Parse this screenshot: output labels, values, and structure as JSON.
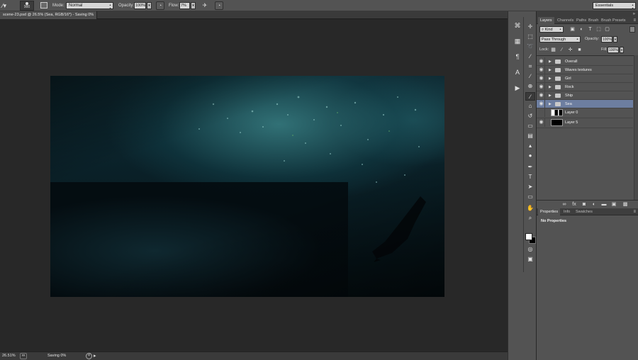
{
  "options_bar": {
    "brush_size": "900",
    "mode_label": "Mode:",
    "mode_value": "Normal",
    "opacity_label": "Opacity:",
    "opacity_value": "100%",
    "flow_label": "Flow:",
    "flow_value": "7%",
    "workspace": "Essentials"
  },
  "document": {
    "tab_title": "scene-23.psd @ 26.5% (Sea, RGB/16*) - Saving 0%"
  },
  "status_bar": {
    "zoom": "26.51%",
    "status": "Saving 0%"
  },
  "layers_panel": {
    "tabs": [
      "Layers",
      "Channels",
      "Paths",
      "Brush",
      "Brush Presets"
    ],
    "kind_filter": "Kind",
    "blend_mode": "Pass Through",
    "opacity_label": "Opacity:",
    "opacity_value": "100%",
    "lock_label": "Lock:",
    "fill_label": "Fill:",
    "fill_value": "100%",
    "layers": [
      {
        "name": "Overall",
        "type": "group",
        "visible": true,
        "selected": false
      },
      {
        "name": "Waves textures",
        "type": "group",
        "visible": true,
        "selected": false
      },
      {
        "name": "Girl",
        "type": "group",
        "visible": true,
        "selected": false
      },
      {
        "name": "Rock",
        "type": "group",
        "visible": true,
        "selected": false
      },
      {
        "name": "Ship",
        "type": "group",
        "visible": true,
        "selected": false
      },
      {
        "name": "Sea",
        "type": "group",
        "visible": true,
        "selected": true
      },
      {
        "name": "Layer 0",
        "type": "pixel",
        "visible": false,
        "selected": false
      },
      {
        "name": "Layer 5",
        "type": "pixel",
        "visible": true,
        "selected": false
      }
    ]
  },
  "properties_panel": {
    "tabs": [
      "Properties",
      "Info",
      "Swatches"
    ],
    "message": "No Properties"
  },
  "colors": {
    "ui_panel": "#535353",
    "ui_dark": "#282828",
    "selected_layer": "#6d7ea0",
    "foreground": "#ffffff",
    "background": "#000000"
  }
}
